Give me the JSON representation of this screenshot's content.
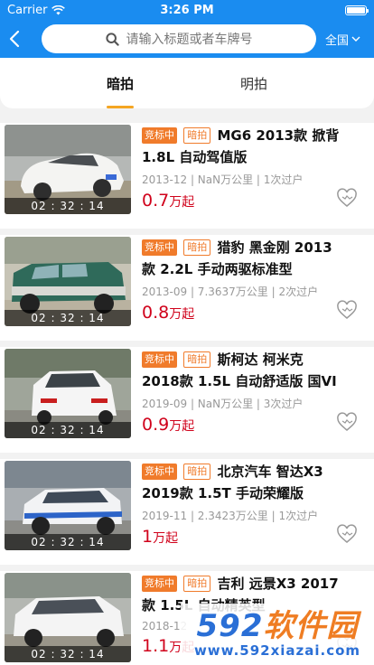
{
  "status_bar": {
    "carrier": "Carrier",
    "time": "3:26 PM"
  },
  "header": {
    "search_placeholder": "请输入标题或者车牌号",
    "region": "全国"
  },
  "tabs": [
    {
      "label": "暗拍",
      "active": true
    },
    {
      "label": "明拍",
      "active": false
    }
  ],
  "cars": [
    {
      "timer": "02 : 32 : 14",
      "status": "竞标中",
      "type": "暗拍",
      "title": "MG6 2013款 掀背 1.8L 自动驾值版",
      "meta": "2013-12 | NaN万公里 | 1次过户",
      "price": "0.7",
      "unit": "万起"
    },
    {
      "timer": "02 : 32 : 14",
      "status": "竞标中",
      "type": "暗拍",
      "title": "猎豹 黑金刚 2013款 2.2L 手动两驱标准型",
      "meta": "2013-09 | 7.3637万公里 | 2次过户",
      "price": "0.8",
      "unit": "万起"
    },
    {
      "timer": "02 : 32 : 14",
      "status": "竞标中",
      "type": "暗拍",
      "title": "斯柯达 柯米克 2018款 1.5L 自动舒适版 国VI",
      "meta": "2019-09 | NaN万公里 | 3次过户",
      "price": "0.9",
      "unit": "万起"
    },
    {
      "timer": "02 : 32 : 14",
      "status": "竞标中",
      "type": "暗拍",
      "title": "北京汽车 智达X3 2019款 1.5T 手动荣耀版",
      "meta": "2019-11 | 2.3423万公里 | 1次过户",
      "price": "1",
      "unit": "万起"
    },
    {
      "timer": "02 : 32 : 14",
      "status": "竞标中",
      "type": "暗拍",
      "title": "吉利 远景X3 2017款 1.5L 自动精英型",
      "meta": "2018-12",
      "price": "1.1",
      "unit": "万起"
    }
  ],
  "watermark": {
    "logo_main": "592",
    "logo_suffix": "软件园",
    "url": "www.592xiazai.com"
  },
  "colors": {
    "primary": "#1a8cf0",
    "accent_orange": "#f07b2b",
    "price_red": "#d0021b",
    "tab_underline": "#f5a623"
  }
}
